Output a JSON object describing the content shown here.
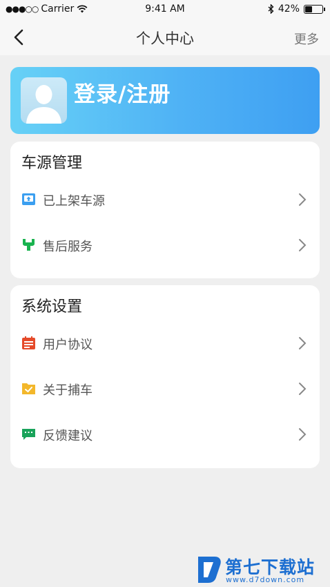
{
  "status_bar": {
    "signal": "●●●○○",
    "carrier": "Carrier",
    "time": "9:41 AM",
    "battery_text": "42%",
    "battery_level": 0.42
  },
  "nav": {
    "title": "个人中心",
    "more_label": "更多"
  },
  "login": {
    "label": "登录/注册"
  },
  "sections": [
    {
      "title": "车源管理",
      "items": [
        {
          "label": "已上架车源",
          "icon": "car-listing-icon",
          "color": "#3b9ff0"
        },
        {
          "label": "售后服务",
          "icon": "wrench-icon",
          "color": "#19b34f"
        }
      ]
    },
    {
      "title": "系统设置",
      "items": [
        {
          "label": "用户协议",
          "icon": "calendar-icon",
          "color": "#e54a2a"
        },
        {
          "label": "关于捕车",
          "icon": "folder-check-icon",
          "color": "#f3b72b"
        },
        {
          "label": "反馈建议",
          "icon": "chat-icon",
          "color": "#19a35a"
        }
      ]
    }
  ],
  "watermark": {
    "title": "第七下载站",
    "url": "www.d7down.com",
    "color": "#1d6fd1"
  }
}
